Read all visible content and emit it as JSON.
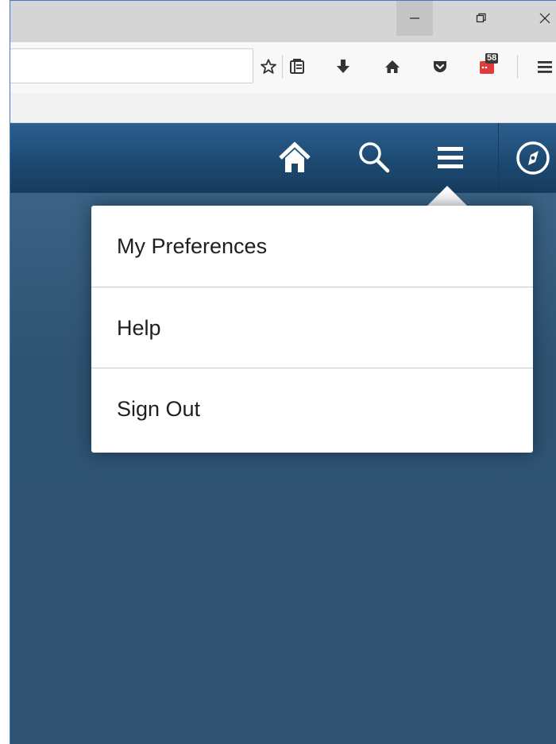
{
  "browser": {
    "window_controls": {
      "minimize_icon": "minimize-icon",
      "restore_icon": "restore-icon",
      "close_icon": "close-icon"
    },
    "toolbar": {
      "icons": [
        "star-icon",
        "reader-list-icon",
        "download-icon",
        "home-icon",
        "pocket-icon",
        "extension-icon",
        "hamburger-menu-icon"
      ],
      "extension_badge_count": "58",
      "extension_color": "#e03a3a"
    }
  },
  "app": {
    "header": {
      "icons": [
        "home-icon",
        "search-icon",
        "menu-icon",
        "compass-icon"
      ],
      "gradient_top": "#2c5f8f",
      "gradient_bottom": "#163c5e"
    },
    "menu": {
      "items": [
        {
          "label": "My Preferences"
        },
        {
          "label": "Help"
        },
        {
          "label": "Sign Out"
        }
      ]
    }
  }
}
